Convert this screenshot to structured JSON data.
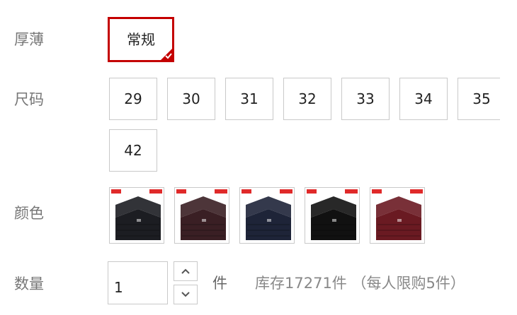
{
  "thickness": {
    "label": "厚薄",
    "options": [
      {
        "text": "常规",
        "selected": true
      }
    ]
  },
  "size": {
    "label": "尺码",
    "options": [
      "29",
      "30",
      "31",
      "32",
      "33",
      "34",
      "35",
      "42"
    ]
  },
  "color": {
    "label": "颜色",
    "swatches": [
      {
        "name": "黑色",
        "hex": "#1c1d22"
      },
      {
        "name": "酒红",
        "hex": "#3a1f24"
      },
      {
        "name": "藏青",
        "hex": "#1e2438"
      },
      {
        "name": "纯黑",
        "hex": "#111111"
      },
      {
        "name": "红色",
        "hex": "#6a1a22"
      }
    ],
    "accent": "#e02a2a"
  },
  "quantity": {
    "label": "数量",
    "value": "1",
    "unit": "件",
    "stock_text": "库存17271件 （每人限购5件）"
  },
  "colors": {
    "selected_border": "#c40000",
    "border": "#c9c9c9",
    "label": "#777777"
  }
}
